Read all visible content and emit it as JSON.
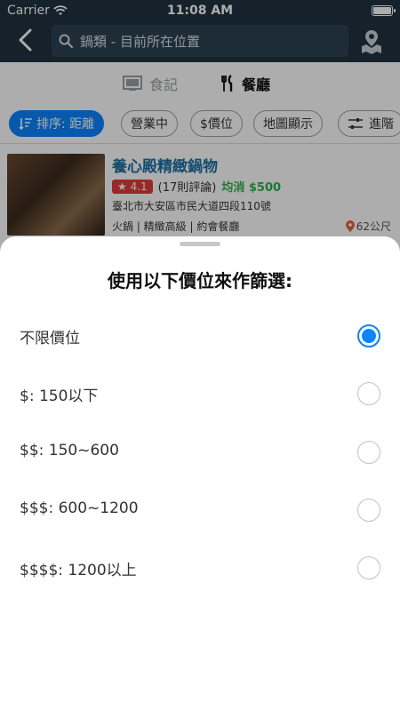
{
  "status": {
    "carrier": "Carrier",
    "time": "11:08 AM"
  },
  "search": {
    "value": "鍋類 - 目前所在位置"
  },
  "tabs": [
    {
      "label": "食記"
    },
    {
      "label": "餐廳"
    }
  ],
  "filters": [
    {
      "label": "排序: 距離",
      "active": true
    },
    {
      "label": "營業中"
    },
    {
      "label": "$價位"
    },
    {
      "label": "地圖顯示"
    },
    {
      "label": "進階"
    }
  ],
  "result": {
    "name": "養心殿精緻鍋物",
    "rating": "★ 4.1",
    "reviews": "(17則評論)",
    "avg_price": "均消 $500",
    "address": "臺北市大安區市民大道四段110號",
    "tags": "火鍋 | 精緻高級 | 約會餐廳",
    "distance": "62公尺"
  },
  "sheet": {
    "title": "使用以下價位來作篩選:",
    "options": [
      {
        "label": "不限價位",
        "selected": true
      },
      {
        "label": "$: 150以下",
        "selected": false
      },
      {
        "label": "$$: 150~600",
        "selected": false
      },
      {
        "label": "$$$: 600~1200",
        "selected": false
      },
      {
        "label": "$$$$: 1200以上",
        "selected": false
      }
    ]
  },
  "colors": {
    "accent": "#0a84ff",
    "navbar": "#1f3340",
    "rating": "#e23d3d",
    "price": "#2db34a",
    "link": "#1c6fa3"
  }
}
